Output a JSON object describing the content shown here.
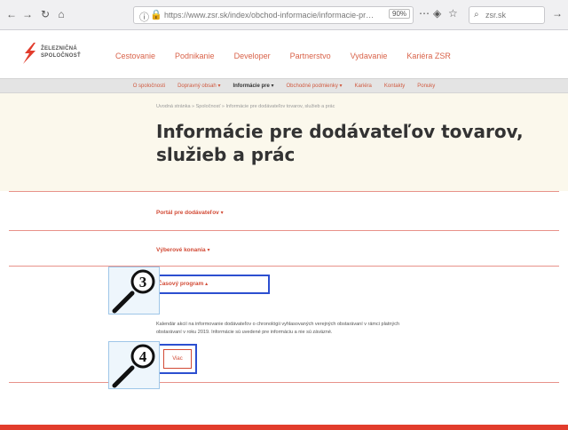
{
  "browser": {
    "url": "https://www.zsr.sk/index/obchod-informacie/informacie-pre-dodavatelov",
    "zoom": "90%",
    "search_placeholder": "zsr.sk"
  },
  "header": {
    "logo_text_line1": "ŽELEZNIČNÁ",
    "logo_text_line2": "SPOLOČNOSŤ",
    "nav_items": [
      "Cestovanie",
      "Podnikanie",
      "Developer",
      "Partnerstvo",
      "Vydavanie",
      "Kariéra ZSR"
    ]
  },
  "subnav": {
    "items": [
      "O spoločnosti",
      "Dopravný obsah ▾",
      "Informácie pre ▾",
      "Obchodné podmienky ▾",
      "Kariéra",
      "Kontakty",
      "Ponuky"
    ],
    "active_index": 2
  },
  "hero": {
    "breadcrumb": "Úvodná stránka » Spoločnosť » Informácie pre dodávateľov tovarov, služieb a prác",
    "title_line1": "Informácie pre dodávateľov tovarov,",
    "title_line2": "služieb a prác"
  },
  "accordion": [
    {
      "label": "Portál pre dodávateľov",
      "caret": "▾"
    },
    {
      "label": "Výberové konania",
      "caret": "▾"
    },
    {
      "label": "Časový program",
      "caret": "▴"
    }
  ],
  "content": {
    "body_line1": "Kalendár akcií na informovanie dodávateľov o chronológii vyhlasovaných verejných obstarávaní v rámci platných",
    "body_line2": "obstarávaní v roku 2019. Informácie sú uvedené pre informáciu a nie sú záväzné.",
    "button_label": "Viac"
  },
  "callouts": [
    {
      "number": "3"
    },
    {
      "number": "4"
    }
  ],
  "colors": {
    "accent": "#d24a35",
    "highlight": "#2c4fd0",
    "hero_bg": "#fbf8ec",
    "footer": "#e23c2c"
  }
}
